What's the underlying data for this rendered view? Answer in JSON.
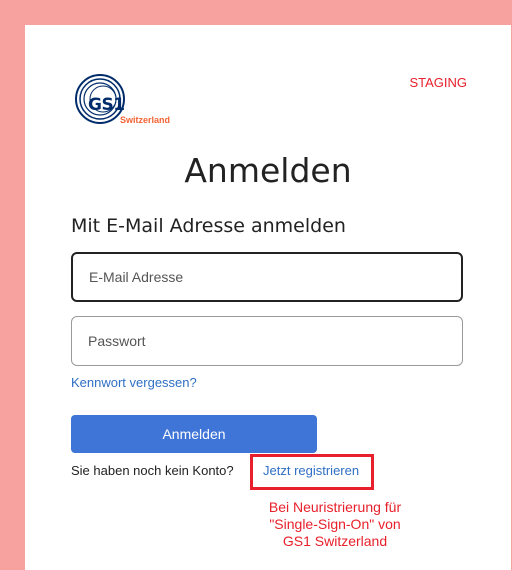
{
  "brand": {
    "logo_mark": "GS1",
    "logo_region": "Switzerland",
    "env_badge": "STAGING"
  },
  "page": {
    "title": "Anmelden",
    "subtitle": "Mit E-Mail Adresse anmelden"
  },
  "form": {
    "email_placeholder": "E-Mail Adresse",
    "password_placeholder": "Passwort",
    "forgot_link": "Kennwort vergessen?",
    "submit_label": "Anmelden"
  },
  "signup": {
    "prompt": "Sie haben noch kein Konto?",
    "link": "Jetzt registrieren"
  },
  "annotation": {
    "lines": [
      "Bei Neuristrierung für",
      "\"Single-Sign-On\" von",
      "GS1 Switzerland"
    ]
  },
  "colors": {
    "frame": "#f8a29f",
    "accent": "#3f75d6",
    "annotation": "#e8202b",
    "link": "#2f6fc4"
  }
}
